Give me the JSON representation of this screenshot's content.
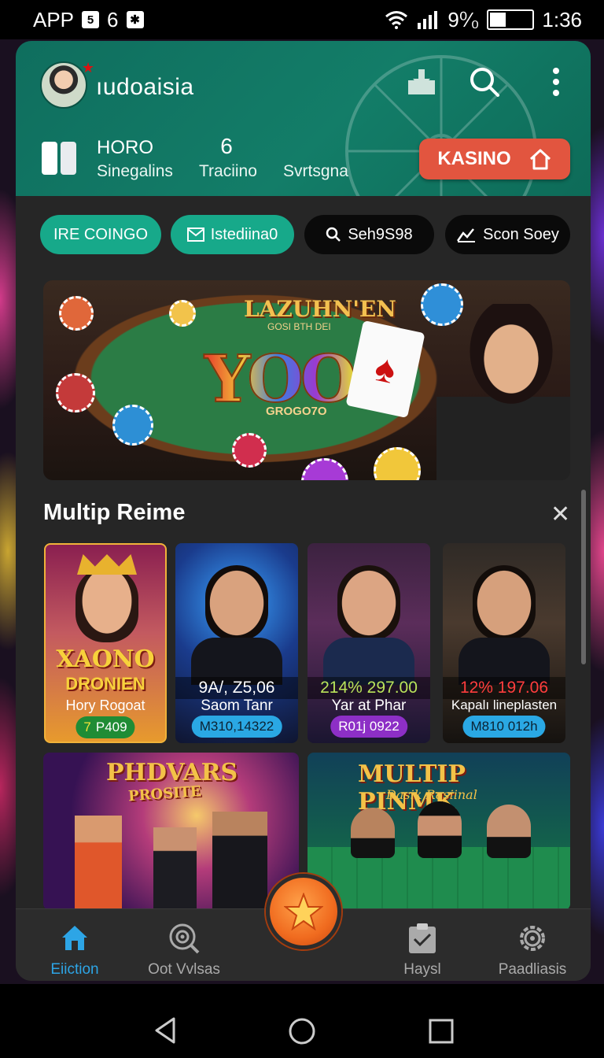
{
  "status_bar": {
    "app_label": "APP",
    "notif_icons": [
      "5",
      "6",
      "✱"
    ],
    "network": "9⁰⁄₀",
    "time": "1:36"
  },
  "header": {
    "username": "ıudoaisia",
    "stats": [
      {
        "top": "HORO",
        "bottom": "Sinegalins"
      },
      {
        "top": "6",
        "bottom": "Traciino"
      },
      {
        "top": "",
        "bottom": "Svrtsgna"
      }
    ],
    "kasino_label": "KASINO"
  },
  "chips": [
    {
      "label": "IRE COINGO"
    },
    {
      "label": "Istediina0"
    },
    {
      "label": "Seh9S98"
    },
    {
      "label": "Scon Soey"
    }
  ],
  "banner": {
    "title": "LAZUHN'EN",
    "subtitle": "GOSI BTH DEI",
    "big_text": "YOO",
    "small_text": "GROGO7O"
  },
  "section": {
    "title": "Multip Reime"
  },
  "tiles": [
    {
      "title": "XAONO",
      "subtitle": "DRONIEN",
      "name": "Hory Rogoat",
      "pill": "P409",
      "pill_prefix": "7"
    },
    {
      "amount": "9A/, Z5,06",
      "name": "Saom Tanr",
      "pill": "M310,14322"
    },
    {
      "amount": "214% 297.00",
      "name": "Yar at Phar",
      "pill": "R01j 0922"
    },
    {
      "amount": "12% 197.06",
      "name": "Kapalı lineplasten",
      "pill": "M810 012h"
    }
  ],
  "big_tiles": [
    {
      "title": "PHDVARS",
      "subtitle": "PROSITE"
    },
    {
      "title": "MULTIP PINMK",
      "subtitle": "Dasik Rasiinal"
    }
  ],
  "bottom_nav": [
    {
      "label": "Eiiction",
      "icon": "home-icon",
      "active": true
    },
    {
      "label": "Oot Vvlsas",
      "icon": "target-icon",
      "active": false
    },
    {
      "label": "Haysl",
      "icon": "clipboard-icon",
      "active": false
    },
    {
      "label": "Paadliasis",
      "icon": "gear-icon",
      "active": false
    }
  ],
  "colors": {
    "header_green": "#137d68",
    "kasino_red": "#e2553f",
    "chip_teal": "#17a98a",
    "active_blue": "#2da5e6",
    "fab_orange": "#f06b1f"
  }
}
